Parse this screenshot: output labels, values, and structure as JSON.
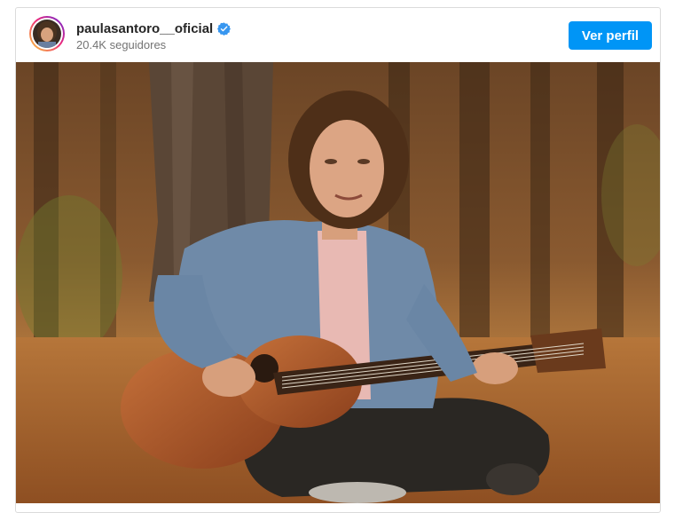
{
  "post": {
    "username": "paulasantoro__oficial",
    "verified": true,
    "followers_text": "20.4K seguidores",
    "profile_button_label": "Ver perfil"
  },
  "colors": {
    "brand_blue": "#0095f6",
    "verified_blue": "#3897f0",
    "username_text": "#262626",
    "secondary_text": "#737373",
    "card_border": "#dbdbdb"
  },
  "icons": {
    "verified": "verified-badge-icon"
  }
}
